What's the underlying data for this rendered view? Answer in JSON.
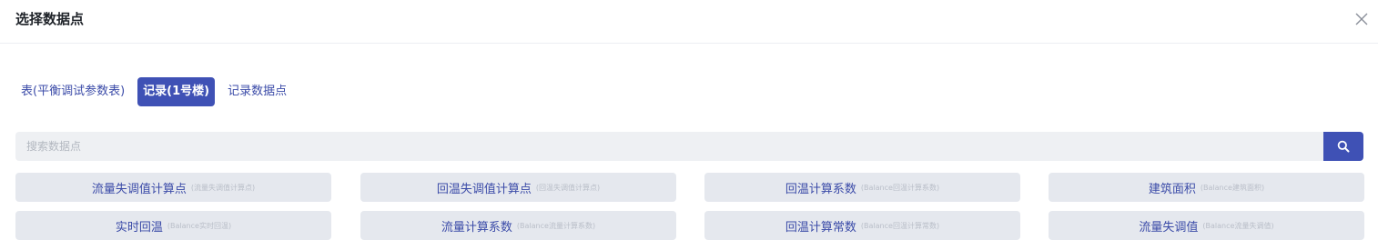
{
  "dialog": {
    "title": "选择数据点"
  },
  "tabs": [
    {
      "label": "表(平衡调试参数表)",
      "active": false
    },
    {
      "label": "记录(1号楼)",
      "active": true
    },
    {
      "label": "记录数据点",
      "active": false
    }
  ],
  "search": {
    "placeholder": "搜索数据点",
    "value": ""
  },
  "items": [
    {
      "name": "流量失调值计算点",
      "sub": "(流量失调值计算点)"
    },
    {
      "name": "回温失调值计算点",
      "sub": "(回温失调值计算点)"
    },
    {
      "name": "回温计算系数",
      "sub": "(Balance回温计算系数)"
    },
    {
      "name": "建筑面积",
      "sub": "(Balance建筑面积)"
    },
    {
      "name": "实时回温",
      "sub": "(Balance实时回温)"
    },
    {
      "name": "流量计算系数",
      "sub": "(Balance流量计算系数)"
    },
    {
      "name": "回温计算常数",
      "sub": "(Balance回温计算常数)"
    },
    {
      "name": "流量失调值",
      "sub": "(Balance流量失调值)"
    }
  ],
  "colors": {
    "accent": "#3f51b5",
    "item_bg": "#e5e8ee",
    "link_text": "#3b4ba8"
  },
  "icons": {
    "close": "close-icon",
    "search": "search-icon"
  }
}
